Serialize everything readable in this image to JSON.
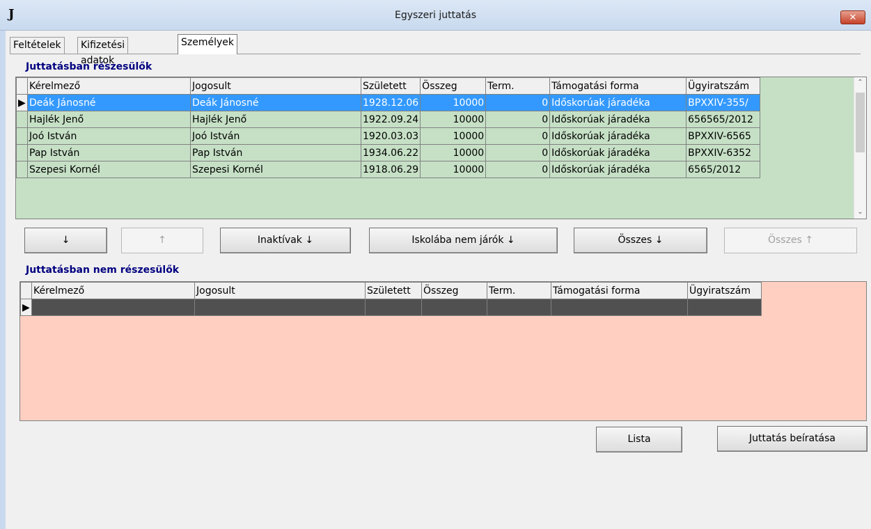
{
  "window": {
    "title": "Egyszeri juttatás",
    "icon_letter": "J",
    "close_glyph": "✕"
  },
  "tabs": [
    "Feltételek",
    "Kifizetési adatok",
    "Személyek"
  ],
  "section_top": "Juttatásban részesülők",
  "section_bottom": "Juttatásban nem részesülők",
  "columns": [
    "Kérelmező",
    "Jogosult",
    "Született",
    "Összeg",
    "Term.",
    "Támogatási forma",
    "Ügyiratszám"
  ],
  "rows": [
    [
      "Deák Jánosné",
      "Deák Jánosné",
      "1928.12.06",
      "10000",
      "0",
      "Időskorúak járadéka",
      "BPXXIV-355/"
    ],
    [
      "Hajlék Jenő",
      "Hajlék Jenő",
      "1922.09.24",
      "10000",
      "0",
      "Időskorúak járadéka",
      "656565/2012"
    ],
    [
      "Joó István",
      "Joó István",
      "1920.03.03",
      "10000",
      "0",
      "Időskorúak járadéka",
      "BPXXIV-6565"
    ],
    [
      "Pap István",
      "Pap István",
      "1934.06.22",
      "10000",
      "0",
      "Időskorúak járadéka",
      "BPXXIV-6352"
    ],
    [
      "Szepesi Kornél",
      "Szepesi Kornél",
      "1918.06.29",
      "10000",
      "0",
      "Időskorúak járadéka",
      "6565/2012"
    ]
  ],
  "row_indicator": "▶",
  "scroll": {
    "up": "⌃",
    "down": "⌄"
  },
  "buttons": {
    "move_down": "↓",
    "move_up": "↑",
    "inactive_down": "Inaktívak ↓",
    "not_school_down": "Iskolába nem járók ↓",
    "all_down": "Összes ↓",
    "all_up": "Összes ↑",
    "lista": "Lista",
    "juttatas": "Juttatás beíratása"
  }
}
